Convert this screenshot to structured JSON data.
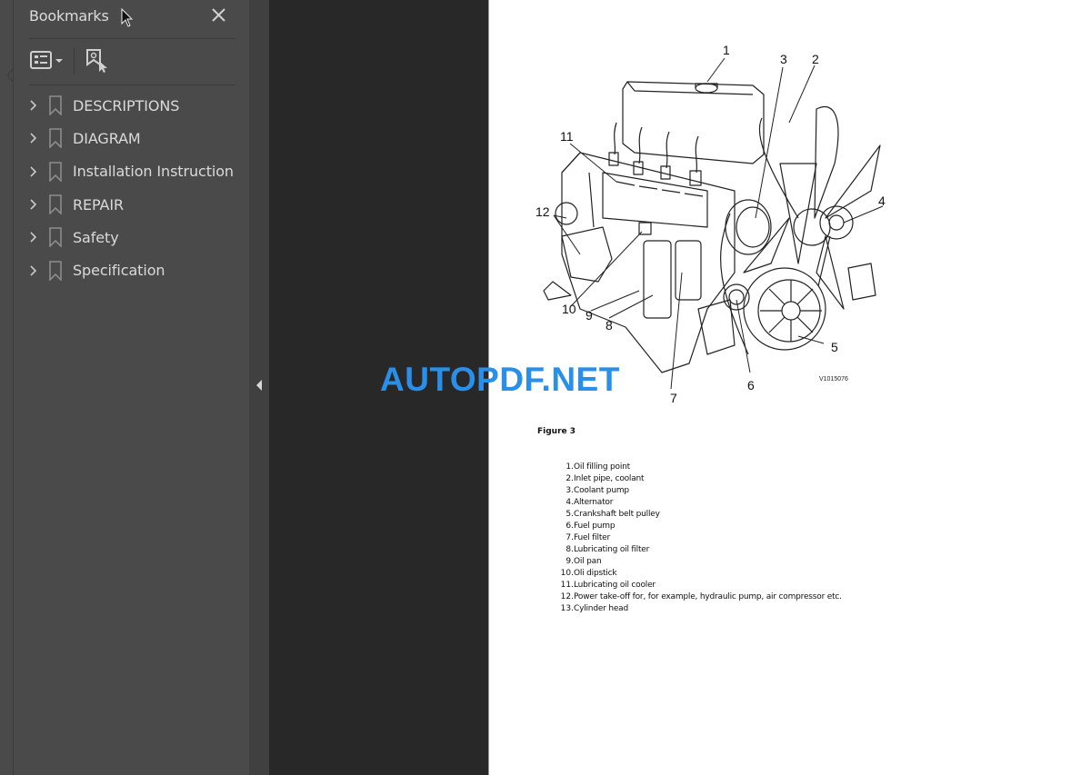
{
  "sidebar": {
    "title": "Bookmarks",
    "close_icon": "close-icon",
    "toolbar": {
      "options_icon": "list-options-icon",
      "find_icon": "find-current-bookmark-icon"
    },
    "items": [
      {
        "label": "DESCRIPTIONS",
        "icon": "bookmark-icon",
        "expandable": true
      },
      {
        "label": "DIAGRAM",
        "icon": "bookmark-icon",
        "expandable": true
      },
      {
        "label": "Installation Instruction",
        "icon": "bookmark-icon",
        "expandable": true
      },
      {
        "label": "REPAIR",
        "icon": "bookmark-icon",
        "expandable": true
      },
      {
        "label": "Safety",
        "icon": "bookmark-icon",
        "expandable": true
      },
      {
        "label": "Specification",
        "icon": "bookmark-icon",
        "expandable": true
      }
    ]
  },
  "splitter": {
    "collapse_icon": "triangle-left-icon"
  },
  "document": {
    "figure": {
      "callouts": [
        "1",
        "2",
        "3",
        "4",
        "5",
        "6",
        "7",
        "8",
        "9",
        "10",
        "11",
        "12"
      ],
      "code": "V1015076",
      "caption": "Figure 3"
    },
    "parts": [
      {
        "num": "1.",
        "text": "Oil filling point"
      },
      {
        "num": "2.",
        "text": "Inlet pipe, coolant"
      },
      {
        "num": "3.",
        "text": "Coolant pump"
      },
      {
        "num": "4.",
        "text": "Alternator"
      },
      {
        "num": "5.",
        "text": "Crankshaft belt pulley"
      },
      {
        "num": "6.",
        "text": "Fuel pump"
      },
      {
        "num": "7.",
        "text": "Fuel filter"
      },
      {
        "num": "8.",
        "text": "Lubricating oil filter"
      },
      {
        "num": "9.",
        "text": "Oil pan"
      },
      {
        "num": "10.",
        "text": "Oli dipstick"
      },
      {
        "num": "11.",
        "text": "Lubricating oil cooler"
      },
      {
        "num": "12.",
        "text": "Power take-off for, for example, hydraulic pump, air compressor etc."
      },
      {
        "num": "13.",
        "text": "Cylinder head"
      }
    ]
  },
  "watermark": {
    "text": "AUTOPDF.NET",
    "color": "#2a8fe8"
  }
}
